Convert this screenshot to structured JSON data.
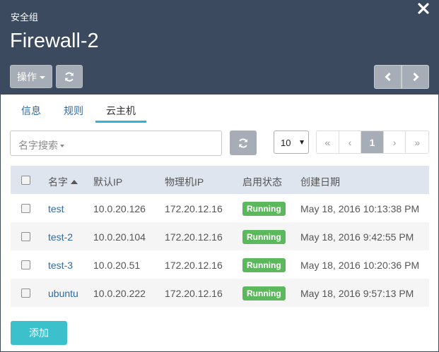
{
  "header": {
    "kicker": "安全组",
    "title": "Firewall-2",
    "action_label": "操作",
    "background": "#3b4a5e"
  },
  "tabs": [
    {
      "label": "信息"
    },
    {
      "label": "规则"
    },
    {
      "label": "云主机",
      "active": true
    }
  ],
  "search": {
    "placeholder": "名字搜索"
  },
  "pagination": {
    "page_size": "10",
    "controls": [
      "«",
      "‹",
      "1",
      "›",
      "»"
    ],
    "current_page": "1"
  },
  "table": {
    "columns": [
      "名字",
      "默认IP",
      "物理机IP",
      "启用状态",
      "创建日期"
    ],
    "rows": [
      {
        "name": "test",
        "ip": "10.0.20.126",
        "host_ip": "172.20.12.16",
        "status": "Running",
        "created": "May 18, 2016 10:13:38 PM"
      },
      {
        "name": "test-2",
        "ip": "10.0.20.104",
        "host_ip": "172.20.12.16",
        "status": "Running",
        "created": "May 18, 2016 9:42:55 PM"
      },
      {
        "name": "test-3",
        "ip": "10.0.20.51",
        "host_ip": "172.20.12.16",
        "status": "Running",
        "created": "May 18, 2016 10:20:36 PM"
      },
      {
        "name": "ubuntu",
        "ip": "10.0.20.222",
        "host_ip": "172.20.12.16",
        "status": "Running",
        "created": "May 18, 2016 9:57:13 PM"
      }
    ]
  },
  "footer": {
    "add_label": "添加"
  },
  "colors": {
    "accent": "#2fb4d8",
    "running": "#5cb85c",
    "add_button": "#3cc0cc",
    "link": "#2d6aa3"
  },
  "icons": [
    "close-icon",
    "refresh-icon",
    "chevron-left-icon",
    "chevron-right-icon",
    "caret-down-icon",
    "sort-up-icon"
  ]
}
